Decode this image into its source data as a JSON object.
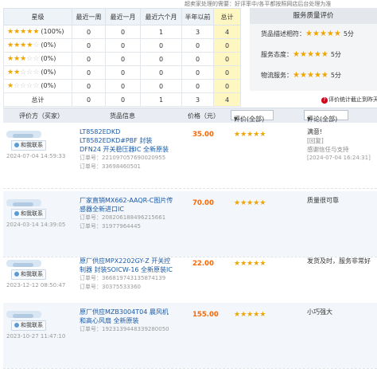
{
  "top_note": "超卖家处理的需要：好评率中/各平都按照网店后台处理为准",
  "stats": {
    "headers": [
      "星级",
      "最近一周",
      "最近一月",
      "最近六个月",
      "半年以前",
      "总计"
    ],
    "rows": [
      {
        "stars": 5,
        "pct": "(100%)",
        "values": [
          "0",
          "0",
          "1",
          "3",
          "4"
        ]
      },
      {
        "stars": 4,
        "pct": "(0%)",
        "values": [
          "0",
          "0",
          "0",
          "0",
          "0"
        ]
      },
      {
        "stars": 3,
        "pct": "(0%)",
        "values": [
          "0",
          "0",
          "0",
          "0",
          "0"
        ]
      },
      {
        "stars": 2,
        "pct": "(0%)",
        "values": [
          "0",
          "0",
          "0",
          "0",
          "0"
        ]
      },
      {
        "stars": 1,
        "pct": "(0%)",
        "values": [
          "0",
          "0",
          "0",
          "0",
          "0"
        ]
      }
    ],
    "total_label": "总计",
    "total_values": [
      "0",
      "0",
      "1",
      "3",
      "4"
    ]
  },
  "service": {
    "title": "服务质量评价",
    "items": [
      {
        "label": "货品描述相符：",
        "stars": 5,
        "score": "5分"
      },
      {
        "label": "服务态度：",
        "stars": 5,
        "score": "5分"
      },
      {
        "label": "物流服务：",
        "stars": 5,
        "score": "5分"
      }
    ]
  },
  "footnote": "评价统计截止到昨天",
  "review_header": {
    "buyer": "评价方（买家）",
    "product": "货品信息",
    "price": "价格（元）",
    "rating_filter": "评价(全部)",
    "content_filter": "评论(全部)"
  },
  "contact_label": "和我联系",
  "order_label": "订单号：",
  "reviews": [
    {
      "time": "2024-07-04 14:59:33",
      "title": "LT8582EDKD LT8582EDKD#PBF 封装DFN24 开关稳压器IC 全新原装",
      "order1": "221097057690020955",
      "order2": "33698460501",
      "price": "35.00",
      "stars": 5,
      "comment": "满意!",
      "reply_label": "[回复]",
      "reply_text": "感谢信任与支持",
      "reply_date": "[2024-07-04 16:24:31]"
    },
    {
      "time": "2024-03-14 14:39:05",
      "title": "厂家直销MX662-AAQR-C图片传感器全新进口IC",
      "order1": "208206188496215661",
      "order2": "31977964445",
      "price": "70.00",
      "stars": 5,
      "comment": "质量很可靠"
    },
    {
      "time": "2023-12-12 08:50:47",
      "title": "原厂供应MPX2202GY-Z 开关控制器 封装SOICW-16 全新原装IC",
      "order1": "366819743135874139",
      "order2": "30375533360",
      "price": "22.00",
      "stars": 5,
      "comment": "发货及时，服务非常好"
    },
    {
      "time": "2023-10-27 11:47:10",
      "title": "原厂供应MZB3004T04 晨风机和高心风扇 全新原装",
      "order1": "1923139448339280050",
      "order2": "",
      "price": "155.00",
      "stars": 5,
      "comment": "小巧强大"
    }
  ],
  "colors": {
    "star_on": "#f0a400",
    "star_off": "#c8c8c8",
    "price": "#ff6600",
    "link": "#1a5aa8",
    "highlight": "#fff7c2"
  }
}
